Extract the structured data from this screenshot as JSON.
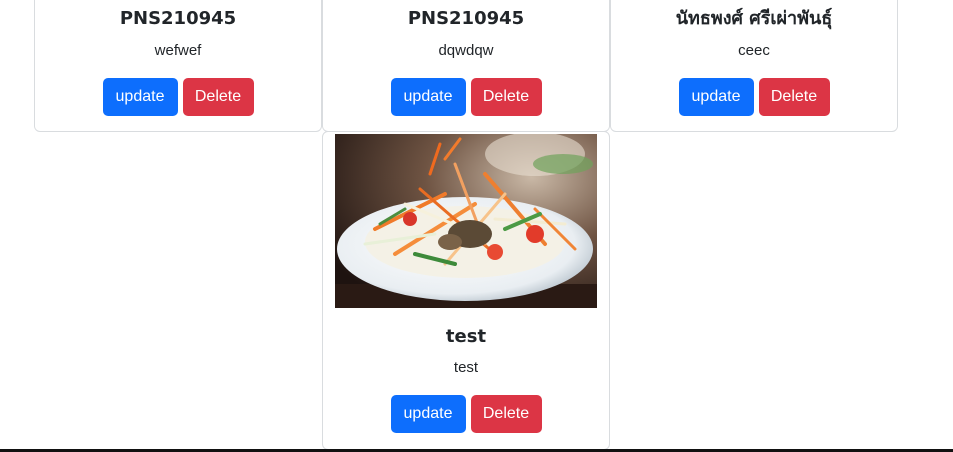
{
  "cards": [
    {
      "title": "PNS210945",
      "text": "wefwef",
      "update_label": "update",
      "delete_label": "Delete"
    },
    {
      "title": "PNS210945",
      "text": "dqwdqw",
      "update_label": "update",
      "delete_label": "Delete"
    },
    {
      "title": "นัทธพงศ์ ศรีเผ่าพันธุ์",
      "text": "ceec",
      "update_label": "update",
      "delete_label": "Delete"
    },
    {
      "title": "test",
      "text": "test",
      "update_label": "update",
      "delete_label": "Delete",
      "image": "food-photo-som-tam-salad"
    }
  ],
  "colors": {
    "update_button": "#0d6efd",
    "delete_button": "#dc3545",
    "card_border": "#d9dcdf"
  }
}
